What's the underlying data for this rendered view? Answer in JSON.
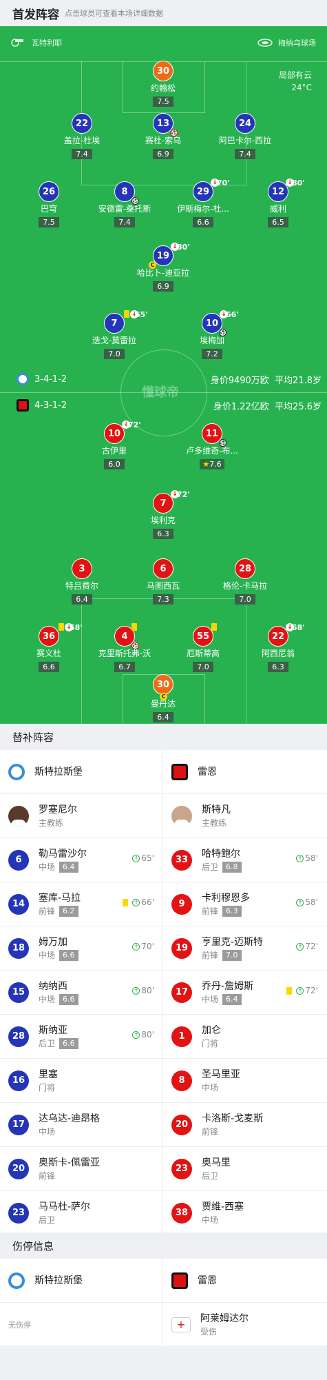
{
  "header": {
    "title": "首发阵容",
    "subtitle": "点击球员可查看本场详细数据"
  },
  "venue": {
    "referee": "瓦特利耶",
    "stadium": "梅纳乌球场"
  },
  "weather": {
    "desc": "局部有云",
    "temp": "24°C"
  },
  "home": {
    "name": "斯特拉斯堡",
    "formation": "3-4-1-2",
    "value": "身价9490万欧",
    "age": "平均21.8岁",
    "players": [
      {
        "num": "30",
        "name": "约翰松",
        "rating": "7.5"
      },
      {
        "num": "22",
        "name": "盖拉-杜埃",
        "rating": "7.4"
      },
      {
        "num": "13",
        "name": "赛杜-索乌",
        "rating": "6.9"
      },
      {
        "num": "24",
        "name": "阿巴卡尔-西拉",
        "rating": "7.4"
      },
      {
        "num": "26",
        "name": "巴穹",
        "rating": "7.5"
      },
      {
        "num": "8",
        "name": "安德雷-桑托斯",
        "rating": "7.4"
      },
      {
        "num": "29",
        "name": "伊斯梅尔-杜...",
        "rating": "6.6",
        "sub": "70'"
      },
      {
        "num": "12",
        "name": "威利",
        "rating": "6.5",
        "sub": "80'"
      },
      {
        "num": "19",
        "name": "哈比卜-迪亚拉",
        "rating": "6.9",
        "sub": "80'"
      },
      {
        "num": "7",
        "name": "迭戈-莫雷拉",
        "rating": "7.0",
        "sub": "65'"
      },
      {
        "num": "10",
        "name": "埃梅加",
        "rating": "7.2",
        "sub": "66'"
      }
    ]
  },
  "away": {
    "name": "雷恩",
    "formation": "4-3-1-2",
    "value": "身价1.22亿欧",
    "age": "平均25.6岁",
    "players": [
      {
        "num": "10",
        "name": "古伊里",
        "rating": "6.0",
        "sub": "72'"
      },
      {
        "num": "11",
        "name": "卢多维奇-布...",
        "rating": "7.6"
      },
      {
        "num": "7",
        "name": "埃利克",
        "rating": "6.3",
        "sub": "72'"
      },
      {
        "num": "3",
        "name": "特吕费尔",
        "rating": "6.4"
      },
      {
        "num": "6",
        "name": "马图西瓦",
        "rating": "7.3"
      },
      {
        "num": "28",
        "name": "格伦-卡马拉",
        "rating": "7.0"
      },
      {
        "num": "36",
        "name": "赛义杜",
        "rating": "6.6",
        "sub": "58'"
      },
      {
        "num": "4",
        "name": "克里斯托弗-沃",
        "rating": "6.7"
      },
      {
        "num": "55",
        "name": "厄斯蒂高",
        "rating": "7.0"
      },
      {
        "num": "22",
        "name": "阿西尼翁",
        "rating": "6.3",
        "sub": "58'"
      },
      {
        "num": "30",
        "name": "曼丹达",
        "rating": "6.4"
      }
    ]
  },
  "watermark": "懂球帝",
  "bench": {
    "title": "替补阵容",
    "home_team": "斯特拉斯堡",
    "away_team": "雷恩",
    "coach_label": "主教练",
    "home_coach": "罗塞尼尔",
    "away_coach": "斯特凡",
    "rows": [
      [
        {
          "num": "6",
          "name": "勒马雷沙尔",
          "pos": "中场",
          "rating": "6.4",
          "sub": "65'"
        },
        {
          "num": "33",
          "name": "哈特鲍尔",
          "pos": "后卫",
          "rating": "6.8",
          "sub": "58'"
        }
      ],
      [
        {
          "num": "14",
          "name": "塞库-马拉",
          "pos": "前锋",
          "rating": "6.2",
          "sub": "66'",
          "yc": true
        },
        {
          "num": "9",
          "name": "卡利穆恩多",
          "pos": "前锋",
          "rating": "6.3",
          "sub": "58'"
        }
      ],
      [
        {
          "num": "18",
          "name": "姆万加",
          "pos": "中场",
          "rating": "6.6",
          "sub": "70'"
        },
        {
          "num": "19",
          "name": "亨里克-迈斯特",
          "pos": "前锋",
          "rating": "7.0",
          "sub": "72'"
        }
      ],
      [
        {
          "num": "15",
          "name": "纳纳西",
          "pos": "中场",
          "rating": "6.6",
          "sub": "80'"
        },
        {
          "num": "17",
          "name": "乔丹-詹姆斯",
          "pos": "中场",
          "rating": "6.4",
          "sub": "72'",
          "yc": true
        }
      ],
      [
        {
          "num": "28",
          "name": "斯纳亚",
          "pos": "后卫",
          "rating": "6.6",
          "sub": "80'"
        },
        {
          "num": "1",
          "name": "加仑",
          "pos": "门将"
        }
      ],
      [
        {
          "num": "16",
          "name": "里塞",
          "pos": "门将"
        },
        {
          "num": "8",
          "name": "圣马里亚",
          "pos": "中场"
        }
      ],
      [
        {
          "num": "17",
          "name": "达乌达-迪昂格",
          "pos": "中场"
        },
        {
          "num": "20",
          "name": "卡洛斯-戈麦斯",
          "pos": "前锋"
        }
      ],
      [
        {
          "num": "20",
          "name": "奥斯卡-佩雷亚",
          "pos": "前锋"
        },
        {
          "num": "23",
          "name": "奥马里",
          "pos": "后卫"
        }
      ],
      [
        {
          "num": "23",
          "name": "马马杜-萨尔",
          "pos": "后卫"
        },
        {
          "num": "38",
          "name": "贾维-西塞",
          "pos": "中场"
        }
      ]
    ]
  },
  "injury": {
    "title": "伤停信息",
    "home_team": "斯特拉斯堡",
    "away_team": "雷恩",
    "home_none": "无伤停",
    "away_player": "阿莱姆达尔",
    "away_status": "受伤"
  },
  "colors": {
    "pitch": "#27b24f",
    "home": "#2535b7",
    "away": "#e31313",
    "gk_home": "#ee6b16"
  }
}
